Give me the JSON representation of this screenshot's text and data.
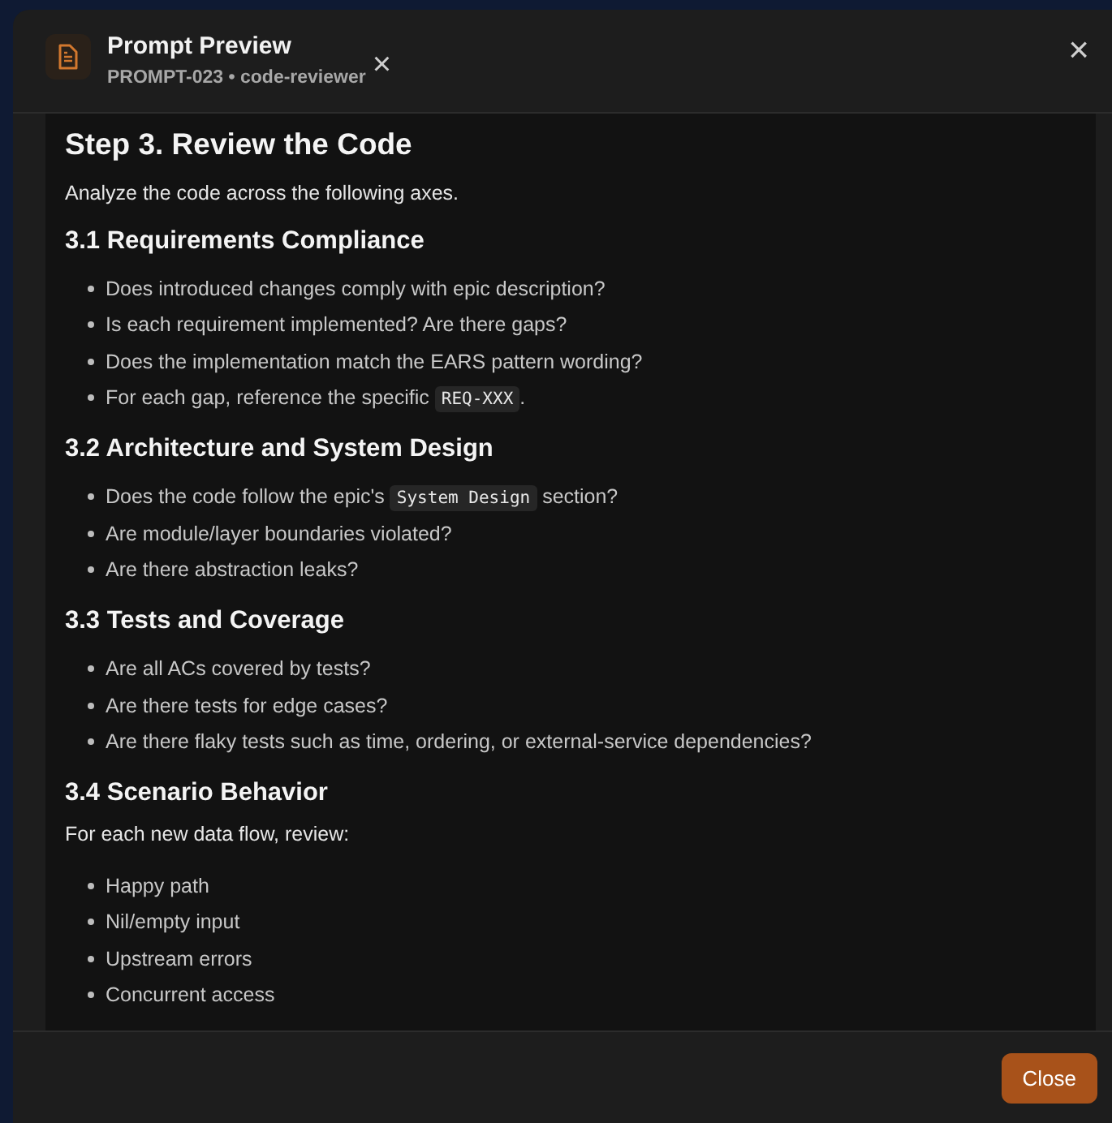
{
  "dialog": {
    "title": "Prompt Preview",
    "subtitle": "PROMPT-023 • code-reviewer",
    "close_glyph": "×",
    "inline_close_glyph": "×"
  },
  "blocks": [
    {
      "kind": "h1",
      "text": "Step 3. Review the Code"
    },
    {
      "kind": "p",
      "text": "Analyze the code across the following axes."
    },
    {
      "kind": "h2",
      "text": "3.1 Requirements Compliance"
    },
    {
      "kind": "ul",
      "items": [
        [
          {
            "kind": "text",
            "text": "Does introduced changes comply with epic description?"
          }
        ],
        [
          {
            "kind": "text",
            "text": "Is each requirement implemented? Are there gaps?"
          }
        ],
        [
          {
            "kind": "text",
            "text": "Does the implementation match the EARS pattern wording?"
          }
        ],
        [
          {
            "kind": "text",
            "text": "For each gap, reference the specific "
          },
          {
            "kind": "code",
            "text": "REQ-XXX"
          },
          {
            "kind": "text",
            "text": "."
          }
        ]
      ]
    },
    {
      "kind": "h2",
      "text": "3.2 Architecture and System Design"
    },
    {
      "kind": "ul",
      "items": [
        [
          {
            "kind": "text",
            "text": "Does the code follow the epic's "
          },
          {
            "kind": "code",
            "text": "System Design"
          },
          {
            "kind": "text",
            "text": " section?"
          }
        ],
        [
          {
            "kind": "text",
            "text": "Are module/layer boundaries violated?"
          }
        ],
        [
          {
            "kind": "text",
            "text": "Are there abstraction leaks?"
          }
        ]
      ]
    },
    {
      "kind": "h2",
      "text": "3.3 Tests and Coverage"
    },
    {
      "kind": "ul",
      "items": [
        [
          {
            "kind": "text",
            "text": "Are all ACs covered by tests?"
          }
        ],
        [
          {
            "kind": "text",
            "text": "Are there tests for edge cases?"
          }
        ],
        [
          {
            "kind": "text",
            "text": "Are there flaky tests such as time, ordering, or external-service dependencies?"
          }
        ]
      ]
    },
    {
      "kind": "h2",
      "text": "3.4 Scenario Behavior"
    },
    {
      "kind": "p",
      "text": "For each new data flow, review:"
    },
    {
      "kind": "ul",
      "items": [
        [
          {
            "kind": "text",
            "text": "Happy path"
          }
        ],
        [
          {
            "kind": "text",
            "text": "Nil/empty input"
          }
        ],
        [
          {
            "kind": "text",
            "text": "Upstream errors"
          }
        ],
        [
          {
            "kind": "text",
            "text": "Concurrent access"
          }
        ]
      ]
    }
  ],
  "footer": {
    "button": "Close"
  }
}
